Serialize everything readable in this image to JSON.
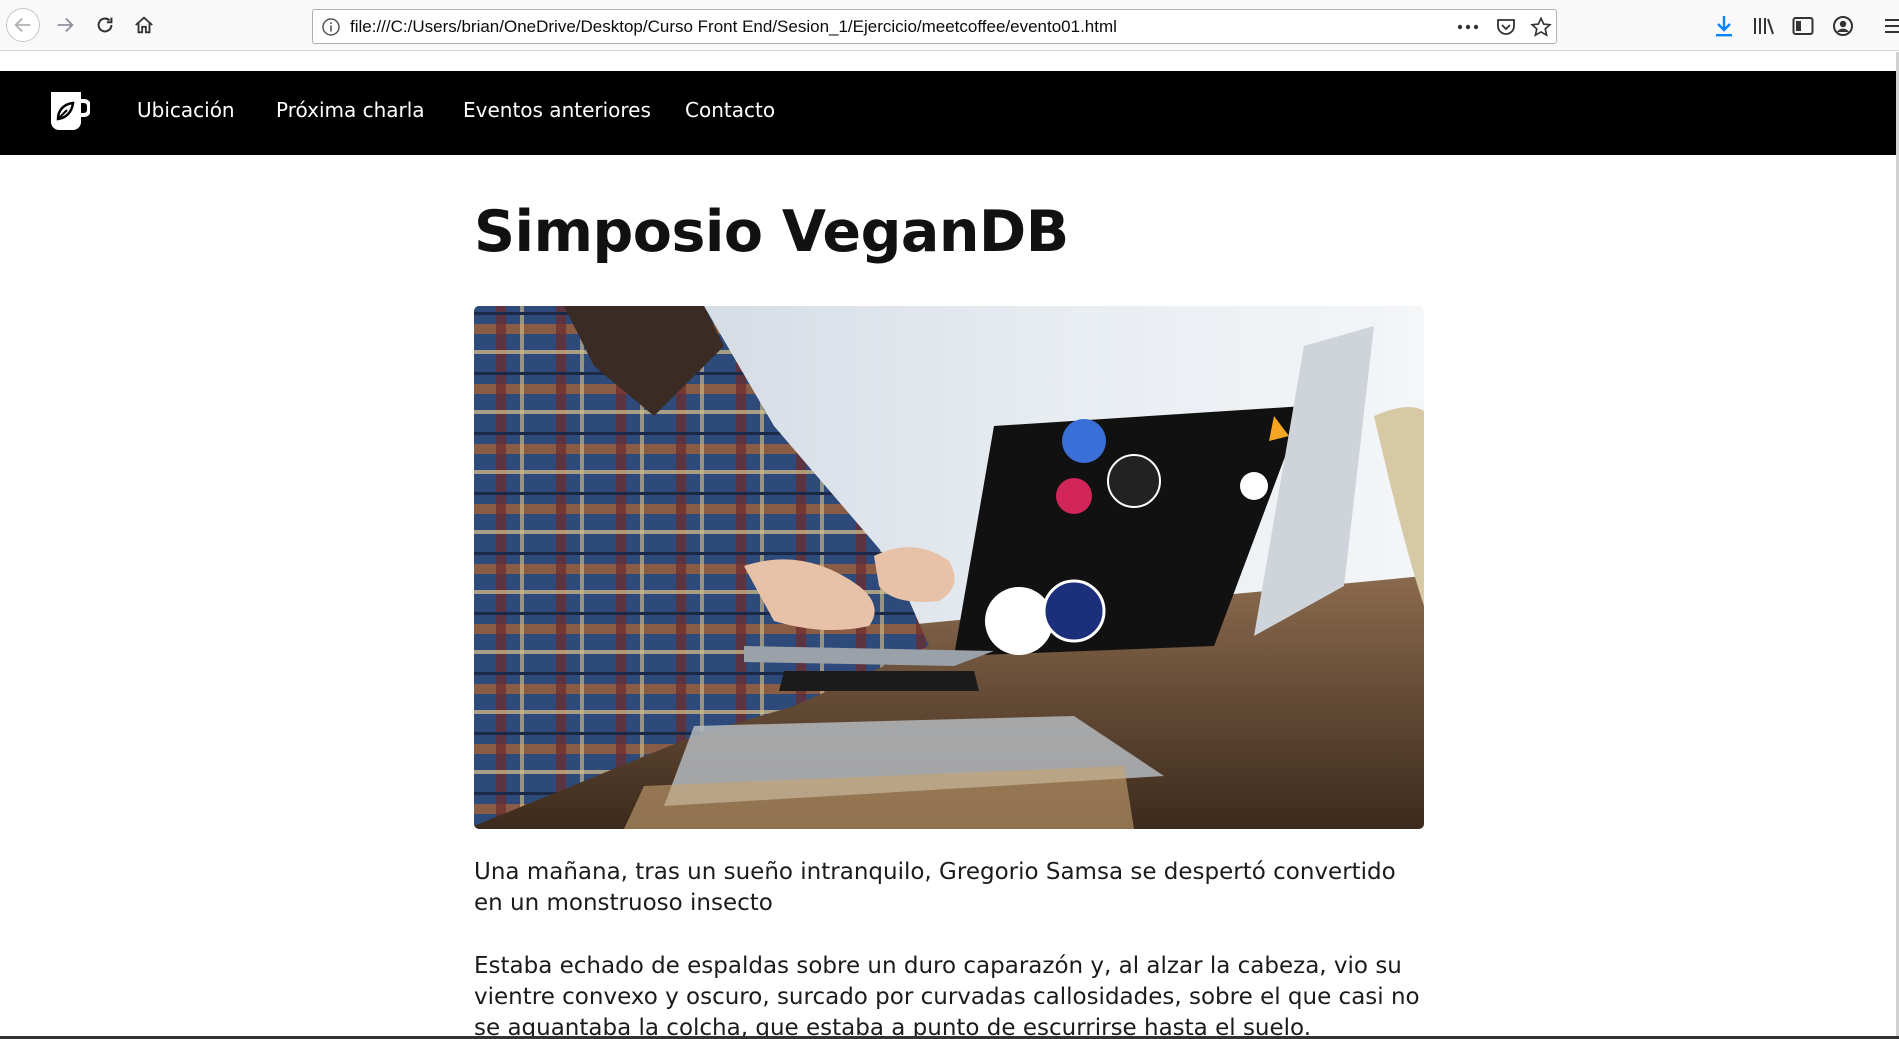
{
  "browser": {
    "url": "file:///C:/Users/brian/OneDrive/Desktop/Curso Front End/Sesion_1/Ejercicio/meetcoffee/evento01.html",
    "icons": [
      "back-icon",
      "forward-icon",
      "reload-icon",
      "home-icon",
      "info-icon",
      "more-icon",
      "pocket-icon",
      "star-icon",
      "download-icon",
      "library-icon",
      "sidebar-icon",
      "account-icon",
      "menu-icon"
    ]
  },
  "site_nav": {
    "logo_icon": "coffee-mug-leaf-icon",
    "links": [
      {
        "label": "Ubicación"
      },
      {
        "label": "Próxima charla"
      },
      {
        "label": "Eventos anteriores"
      },
      {
        "label": "Contacto"
      }
    ]
  },
  "article": {
    "title": "Simposio VeganDB",
    "paragraphs": [
      "Una mañana, tras un sueño intranquilo, Gregorio Samsa se despertó convertido en un monstruoso insecto",
      "Estaba echado de espaldas sobre un duro caparazón y, al alzar la cabeza, vio su vientre convexo y oscuro, surcado por curvadas callosidades, sobre el que casi no se aguantaba la colcha, que estaba a punto de escurrirse hasta el suelo."
    ]
  },
  "colors": {
    "nav_background": "#000000",
    "nav_text": "#ffffff",
    "title_text": "#111111",
    "body_text": "#1b1b1b",
    "download_accent": "#0a84ff"
  }
}
